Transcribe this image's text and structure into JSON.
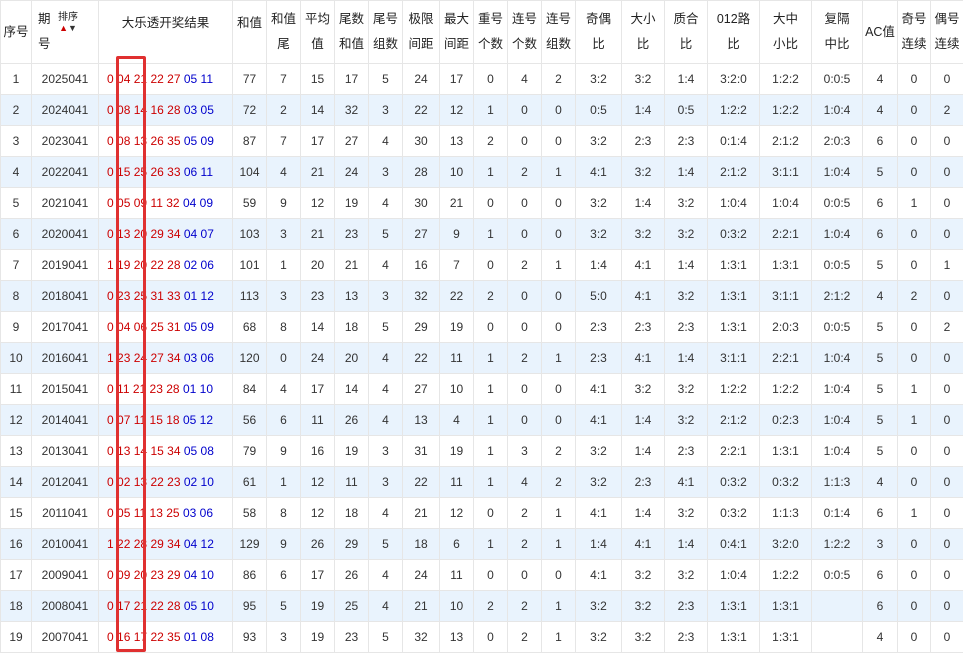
{
  "header": {
    "col_index": "序号",
    "col_period": [
      "期",
      "号"
    ],
    "sort": {
      "label": "排序"
    },
    "col_result": "大乐透开奖结果",
    "col_sum": "和值",
    "col_sum_tail": [
      "和值",
      "尾"
    ],
    "col_avg": [
      "平均",
      "值"
    ],
    "col_tail_sum": [
      "尾数",
      "和值"
    ],
    "col_tail_groups": [
      "尾号",
      "组数"
    ],
    "col_limit_gap": [
      "极限",
      "间距"
    ],
    "col_max_gap": [
      "最大",
      "间距"
    ],
    "col_repeat": [
      "重号",
      "个数"
    ],
    "col_consecutive": [
      "连号",
      "个数"
    ],
    "col_consec_groups": [
      "连号",
      "组数"
    ],
    "col_odd_even": [
      "奇偶",
      "比"
    ],
    "col_big_small": [
      "大小",
      "比"
    ],
    "col_prime_comp": [
      "质合",
      "比"
    ],
    "col_012": [
      "012路",
      "比"
    ],
    "col_bms": [
      "大中",
      "小比"
    ],
    "col_rep_mid": [
      "复隔",
      "中比"
    ],
    "col_ac": "AC值",
    "col_odd_run": [
      "奇号",
      "连续"
    ],
    "col_even_run": [
      "偶号",
      "连续"
    ]
  },
  "rows": [
    {
      "idx": "1",
      "period": "2025041",
      "red": [
        "0",
        "04",
        "21",
        "22",
        "27"
      ],
      "blue": [
        "05",
        "11"
      ],
      "sum": "77",
      "sum_tail": "7",
      "avg": "15",
      "tail_sum": "17",
      "tail_groups": "5",
      "limit_gap": "24",
      "max_gap": "17",
      "repeat": "0",
      "consec": "4",
      "consec_groups": "2",
      "odd_even": "3:2",
      "big_small": "3:2",
      "prime": "1:4",
      "r012": "3:2:0",
      "bms": "1:2:2",
      "rep_mid": "0:0:5",
      "ac": "4",
      "odd_run": "0",
      "even_run": "0"
    },
    {
      "idx": "2",
      "period": "2024041",
      "red": [
        "0",
        "08",
        "14",
        "16",
        "28"
      ],
      "blue": [
        "03",
        "05"
      ],
      "sum": "72",
      "sum_tail": "2",
      "avg": "14",
      "tail_sum": "32",
      "tail_groups": "3",
      "limit_gap": "22",
      "max_gap": "12",
      "repeat": "1",
      "consec": "0",
      "consec_groups": "0",
      "odd_even": "0:5",
      "big_small": "1:4",
      "prime": "0:5",
      "r012": "1:2:2",
      "bms": "1:2:2",
      "rep_mid": "1:0:4",
      "ac": "4",
      "odd_run": "0",
      "even_run": "2"
    },
    {
      "idx": "3",
      "period": "2023041",
      "red": [
        "0",
        "08",
        "13",
        "26",
        "35"
      ],
      "blue": [
        "05",
        "09"
      ],
      "sum": "87",
      "sum_tail": "7",
      "avg": "17",
      "tail_sum": "27",
      "tail_groups": "4",
      "limit_gap": "30",
      "max_gap": "13",
      "repeat": "2",
      "consec": "0",
      "consec_groups": "0",
      "odd_even": "3:2",
      "big_small": "2:3",
      "prime": "2:3",
      "r012": "0:1:4",
      "bms": "2:1:2",
      "rep_mid": "2:0:3",
      "ac": "6",
      "odd_run": "0",
      "even_run": "0"
    },
    {
      "idx": "4",
      "period": "2022041",
      "red": [
        "0",
        "15",
        "25",
        "26",
        "33"
      ],
      "blue": [
        "06",
        "11"
      ],
      "sum": "104",
      "sum_tail": "4",
      "avg": "21",
      "tail_sum": "24",
      "tail_groups": "3",
      "limit_gap": "28",
      "max_gap": "10",
      "repeat": "1",
      "consec": "2",
      "consec_groups": "1",
      "odd_even": "4:1",
      "big_small": "3:2",
      "prime": "1:4",
      "r012": "2:1:2",
      "bms": "3:1:1",
      "rep_mid": "1:0:4",
      "ac": "5",
      "odd_run": "0",
      "even_run": "0"
    },
    {
      "idx": "5",
      "period": "2021041",
      "red": [
        "0",
        "05",
        "09",
        "11",
        "32"
      ],
      "blue": [
        "04",
        "09"
      ],
      "sum": "59",
      "sum_tail": "9",
      "avg": "12",
      "tail_sum": "19",
      "tail_groups": "4",
      "limit_gap": "30",
      "max_gap": "21",
      "repeat": "0",
      "consec": "0",
      "consec_groups": "0",
      "odd_even": "3:2",
      "big_small": "1:4",
      "prime": "3:2",
      "r012": "1:0:4",
      "bms": "1:0:4",
      "rep_mid": "0:0:5",
      "ac": "6",
      "odd_run": "1",
      "even_run": "0"
    },
    {
      "idx": "6",
      "period": "2020041",
      "red": [
        "0",
        "13",
        "20",
        "29",
        "34"
      ],
      "blue": [
        "04",
        "07"
      ],
      "sum": "103",
      "sum_tail": "3",
      "avg": "21",
      "tail_sum": "23",
      "tail_groups": "5",
      "limit_gap": "27",
      "max_gap": "9",
      "repeat": "1",
      "consec": "0",
      "consec_groups": "0",
      "odd_even": "3:2",
      "big_small": "3:2",
      "prime": "3:2",
      "r012": "0:3:2",
      "bms": "2:2:1",
      "rep_mid": "1:0:4",
      "ac": "6",
      "odd_run": "0",
      "even_run": "0"
    },
    {
      "idx": "7",
      "period": "2019041",
      "red": [
        "1",
        "19",
        "20",
        "22",
        "28"
      ],
      "blue": [
        "02",
        "06"
      ],
      "sum": "101",
      "sum_tail": "1",
      "avg": "20",
      "tail_sum": "21",
      "tail_groups": "4",
      "limit_gap": "16",
      "max_gap": "7",
      "repeat": "0",
      "consec": "2",
      "consec_groups": "1",
      "odd_even": "1:4",
      "big_small": "4:1",
      "prime": "1:4",
      "r012": "1:3:1",
      "bms": "1:3:1",
      "rep_mid": "0:0:5",
      "ac": "5",
      "odd_run": "0",
      "even_run": "1"
    },
    {
      "idx": "8",
      "period": "2018041",
      "red": [
        "0",
        "23",
        "25",
        "31",
        "33"
      ],
      "blue": [
        "01",
        "12"
      ],
      "sum": "113",
      "sum_tail": "3",
      "avg": "23",
      "tail_sum": "13",
      "tail_groups": "3",
      "limit_gap": "32",
      "max_gap": "22",
      "repeat": "2",
      "consec": "0",
      "consec_groups": "0",
      "odd_even": "5:0",
      "big_small": "4:1",
      "prime": "3:2",
      "r012": "1:3:1",
      "bms": "3:1:1",
      "rep_mid": "2:1:2",
      "ac": "4",
      "odd_run": "2",
      "even_run": "0"
    },
    {
      "idx": "9",
      "period": "2017041",
      "red": [
        "0",
        "04",
        "06",
        "25",
        "31"
      ],
      "blue": [
        "05",
        "09"
      ],
      "sum": "68",
      "sum_tail": "8",
      "avg": "14",
      "tail_sum": "18",
      "tail_groups": "5",
      "limit_gap": "29",
      "max_gap": "19",
      "repeat": "0",
      "consec": "0",
      "consec_groups": "0",
      "odd_even": "2:3",
      "big_small": "2:3",
      "prime": "2:3",
      "r012": "1:3:1",
      "bms": "2:0:3",
      "rep_mid": "0:0:5",
      "ac": "5",
      "odd_run": "0",
      "even_run": "2"
    },
    {
      "idx": "10",
      "period": "2016041",
      "red": [
        "1",
        "23",
        "24",
        "27",
        "34"
      ],
      "blue": [
        "03",
        "06"
      ],
      "sum": "120",
      "sum_tail": "0",
      "avg": "24",
      "tail_sum": "20",
      "tail_groups": "4",
      "limit_gap": "22",
      "max_gap": "11",
      "repeat": "1",
      "consec": "2",
      "consec_groups": "1",
      "odd_even": "2:3",
      "big_small": "4:1",
      "prime": "1:4",
      "r012": "3:1:1",
      "bms": "2:2:1",
      "rep_mid": "1:0:4",
      "ac": "5",
      "odd_run": "0",
      "even_run": "0"
    },
    {
      "idx": "11",
      "period": "2015041",
      "red": [
        "0",
        "11",
        "21",
        "23",
        "28"
      ],
      "blue": [
        "01",
        "10"
      ],
      "sum": "84",
      "sum_tail": "4",
      "avg": "17",
      "tail_sum": "14",
      "tail_groups": "4",
      "limit_gap": "27",
      "max_gap": "10",
      "repeat": "1",
      "consec": "0",
      "consec_groups": "0",
      "odd_even": "4:1",
      "big_small": "3:2",
      "prime": "3:2",
      "r012": "1:2:2",
      "bms": "1:2:2",
      "rep_mid": "1:0:4",
      "ac": "5",
      "odd_run": "1",
      "even_run": "0"
    },
    {
      "idx": "12",
      "period": "2014041",
      "red": [
        "0",
        "07",
        "11",
        "15",
        "18"
      ],
      "blue": [
        "05",
        "12"
      ],
      "sum": "56",
      "sum_tail": "6",
      "avg": "11",
      "tail_sum": "26",
      "tail_groups": "4",
      "limit_gap": "13",
      "max_gap": "4",
      "repeat": "1",
      "consec": "0",
      "consec_groups": "0",
      "odd_even": "4:1",
      "big_small": "1:4",
      "prime": "3:2",
      "r012": "2:1:2",
      "bms": "0:2:3",
      "rep_mid": "1:0:4",
      "ac": "5",
      "odd_run": "1",
      "even_run": "0"
    },
    {
      "idx": "13",
      "period": "2013041",
      "red": [
        "0",
        "13",
        "14",
        "15",
        "34"
      ],
      "blue": [
        "05",
        "08"
      ],
      "sum": "79",
      "sum_tail": "9",
      "avg": "16",
      "tail_sum": "19",
      "tail_groups": "3",
      "limit_gap": "31",
      "max_gap": "19",
      "repeat": "1",
      "consec": "3",
      "consec_groups": "2",
      "odd_even": "3:2",
      "big_small": "1:4",
      "prime": "2:3",
      "r012": "2:2:1",
      "bms": "1:3:1",
      "rep_mid": "1:0:4",
      "ac": "5",
      "odd_run": "0",
      "even_run": "0"
    },
    {
      "idx": "14",
      "period": "2012041",
      "red": [
        "0",
        "02",
        "13",
        "22",
        "23"
      ],
      "blue": [
        "02",
        "10"
      ],
      "sum": "61",
      "sum_tail": "1",
      "avg": "12",
      "tail_sum": "11",
      "tail_groups": "3",
      "limit_gap": "22",
      "max_gap": "11",
      "repeat": "1",
      "consec": "4",
      "consec_groups": "2",
      "odd_even": "3:2",
      "big_small": "2:3",
      "prime": "4:1",
      "r012": "0:3:2",
      "bms": "0:3:2",
      "rep_mid": "1:1:3",
      "ac": "4",
      "odd_run": "0",
      "even_run": "0"
    },
    {
      "idx": "15",
      "period": "2011041",
      "red": [
        "0",
        "05",
        "11",
        "13",
        "25"
      ],
      "blue": [
        "03",
        "06"
      ],
      "sum": "58",
      "sum_tail": "8",
      "avg": "12",
      "tail_sum": "18",
      "tail_groups": "4",
      "limit_gap": "21",
      "max_gap": "12",
      "repeat": "0",
      "consec": "2",
      "consec_groups": "1",
      "odd_even": "4:1",
      "big_small": "1:4",
      "prime": "3:2",
      "r012": "0:3:2",
      "bms": "1:1:3",
      "rep_mid": "0:1:4",
      "ac": "6",
      "odd_run": "1",
      "even_run": "0"
    },
    {
      "idx": "16",
      "period": "2010041",
      "red": [
        "1",
        "22",
        "28",
        "29",
        "34"
      ],
      "blue": [
        "04",
        "12"
      ],
      "sum": "129",
      "sum_tail": "9",
      "avg": "26",
      "tail_sum": "29",
      "tail_groups": "5",
      "limit_gap": "18",
      "max_gap": "6",
      "repeat": "1",
      "consec": "2",
      "consec_groups": "1",
      "odd_even": "1:4",
      "big_small": "4:1",
      "prime": "1:4",
      "r012": "0:4:1",
      "bms": "3:2:0",
      "rep_mid": "1:2:2",
      "ac": "3",
      "odd_run": "0",
      "even_run": "0"
    },
    {
      "idx": "17",
      "period": "2009041",
      "red": [
        "0",
        "09",
        "20",
        "23",
        "29"
      ],
      "blue": [
        "04",
        "10"
      ],
      "sum": "86",
      "sum_tail": "6",
      "avg": "17",
      "tail_sum": "26",
      "tail_groups": "4",
      "limit_gap": "24",
      "max_gap": "11",
      "repeat": "0",
      "consec": "0",
      "consec_groups": "0",
      "odd_even": "4:1",
      "big_small": "3:2",
      "prime": "3:2",
      "r012": "1:0:4",
      "bms": "1:2:2",
      "rep_mid": "0:0:5",
      "ac": "6",
      "odd_run": "0",
      "even_run": "0"
    },
    {
      "idx": "18",
      "period": "2008041",
      "red": [
        "0",
        "17",
        "21",
        "22",
        "28"
      ],
      "blue": [
        "05",
        "10"
      ],
      "sum": "95",
      "sum_tail": "5",
      "avg": "19",
      "tail_sum": "25",
      "tail_groups": "4",
      "limit_gap": "21",
      "max_gap": "10",
      "repeat": "2",
      "consec": "2",
      "consec_groups": "1",
      "odd_even": "3:2",
      "big_small": "3:2",
      "prime": "2:3",
      "r012": "1:3:1",
      "bms": "1:3:1",
      "rep_mid": "",
      "ac": "6",
      "odd_run": "0",
      "even_run": "0"
    },
    {
      "idx": "19",
      "period": "2007041",
      "red": [
        "0",
        "16",
        "17",
        "22",
        "35"
      ],
      "blue": [
        "01",
        "08"
      ],
      "sum": "93",
      "sum_tail": "3",
      "avg": "19",
      "tail_sum": "23",
      "tail_groups": "5",
      "limit_gap": "32",
      "max_gap": "13",
      "repeat": "0",
      "consec": "2",
      "consec_groups": "1",
      "odd_even": "3:2",
      "big_small": "3:2",
      "prime": "2:3",
      "r012": "1:3:1",
      "bms": "1:3:1",
      "rep_mid": "",
      "ac": "4",
      "odd_run": "0",
      "even_run": "0"
    }
  ],
  "colors": {
    "red_ball": "#cc0000",
    "blue_ball": "#0000cc",
    "row_alt": "#e9f3fd",
    "highlight": "#e03030"
  }
}
